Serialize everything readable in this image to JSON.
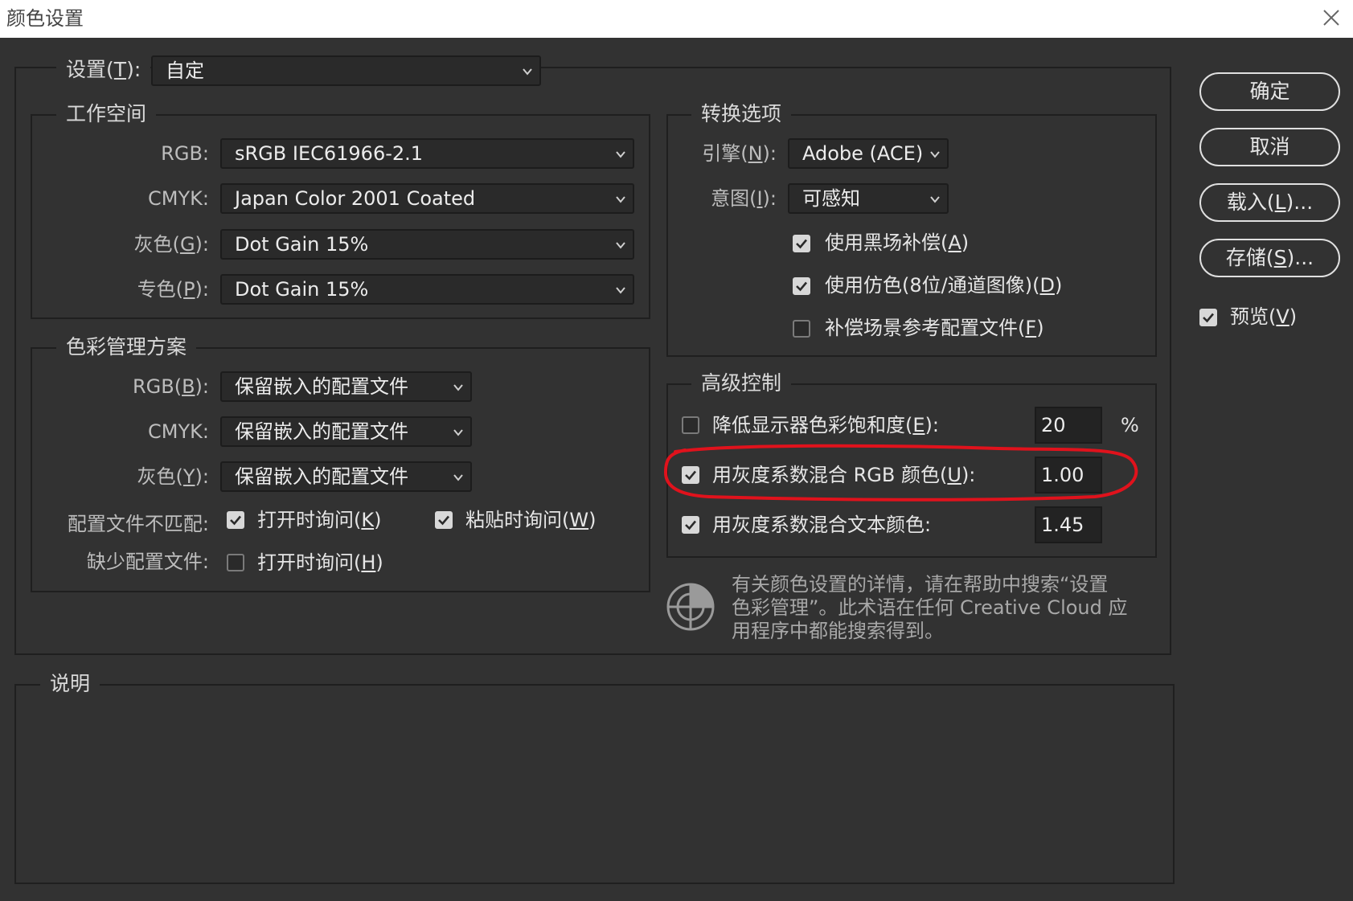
{
  "window": {
    "title": "颜色设置"
  },
  "settings": {
    "label": "设置",
    "key": "T",
    "value": "自定"
  },
  "workspace": {
    "title": "工作空间",
    "rows": [
      {
        "label": "RGB:",
        "value": "sRGB IEC61966-2.1"
      },
      {
        "label": "CMYK:",
        "value": "Japan Color 2001 Coated"
      },
      {
        "label_pre": "灰色(",
        "key": "G",
        "label_post": "):",
        "value": "Dot Gain 15%"
      },
      {
        "label_pre": "专色(",
        "key": "P",
        "label_post": "):",
        "value": "Dot Gain 15%"
      }
    ]
  },
  "color_mgmt": {
    "title": "色彩管理方案",
    "rgb": {
      "label_pre": "RGB(",
      "key": "B",
      "label_post": "):",
      "value": "保留嵌入的配置文件"
    },
    "cmyk": {
      "label": "CMYK:",
      "value": "保留嵌入的配置文件"
    },
    "gray": {
      "label_pre": "灰色(",
      "key": "Y",
      "label_post": "):",
      "value": "保留嵌入的配置文件"
    },
    "mismatch": {
      "label": "配置文件不匹配:",
      "ask_open": {
        "pre": "打开时询问(",
        "key": "K",
        "post": ")",
        "checked": true
      },
      "ask_paste": {
        "pre": "粘贴时询问(",
        "key": "W",
        "post": ")",
        "checked": true
      }
    },
    "missing": {
      "label": "缺少配置文件:",
      "ask_open": {
        "pre": "打开时询问(",
        "key": "H",
        "post": ")",
        "checked": false
      }
    }
  },
  "conversion": {
    "title": "转换选项",
    "engine": {
      "label_pre": "引擎(",
      "key": "N",
      "label_post": "):",
      "value": "Adobe (ACE)"
    },
    "intent": {
      "label_pre": "意图(",
      "key": "I",
      "label_post": "):",
      "value": "可感知"
    },
    "black_point": {
      "pre": "使用黑场补偿(",
      "key": "A",
      "post": ")",
      "checked": true
    },
    "dither": {
      "pre": "使用仿色(8位/通道图像)(",
      "key": "D",
      "post": ")",
      "checked": true
    },
    "scene_ref": {
      "pre": "补偿场景参考配置文件(",
      "key": "F",
      "post": ")",
      "checked": false
    }
  },
  "advanced": {
    "title": "高级控制",
    "desaturate": {
      "pre": "降低显示器色彩饱和度(",
      "key": "E",
      "post": "):",
      "value": "20",
      "unit": "%",
      "checked": false
    },
    "blend_rgb": {
      "pre": "用灰度系数混合 RGB 颜色(",
      "key": "U",
      "post": "):",
      "value": "1.00",
      "checked": true
    },
    "blend_text": {
      "label": "用灰度系数混合文本颜色:",
      "value": "1.45",
      "checked": true
    }
  },
  "help": {
    "lines": [
      "有关颜色设置的详情，请在帮助中搜索“设置",
      "色彩管理”。此术语在任何 Creative Cloud 应",
      "用程序中都能搜索得到。"
    ]
  },
  "description": {
    "title": "说明"
  },
  "buttons": {
    "ok": "确定",
    "cancel": "取消",
    "load": {
      "pre": "载入(",
      "key": "L",
      "post": ")..."
    },
    "save": {
      "pre": "存储(",
      "key": "S",
      "post": ")..."
    }
  },
  "preview": {
    "pre": "预览(",
    "key": "V",
    "post": ")",
    "checked": true
  },
  "colors": {
    "background": "#323232",
    "title_bar": "#ffffff",
    "annotation_red": "#e0121c"
  }
}
